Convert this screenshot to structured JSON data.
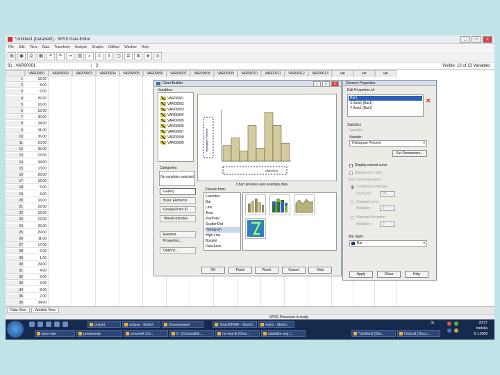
{
  "window": {
    "title": "*Untitled1 [DataSet0] - SPSS Data Editor"
  },
  "menu": [
    "File",
    "Edit",
    "View",
    "Data",
    "Transform",
    "Analyze",
    "Graphs",
    "Utilities",
    "Window",
    "Help"
  ],
  "cellbar": {
    "ref": "61 : VAR00001",
    "value": "2",
    "visible": "Visible: 13 of 13 Variables"
  },
  "columns": [
    "VAR00001",
    "VAR00002",
    "VAR00003",
    "VAR00004",
    "VAR00005",
    "VAR00006",
    "VAR00007",
    "VAR00008",
    "VAR00009",
    "VAR00010",
    "VAR00011",
    "VAR00012",
    "VAR00013",
    "var",
    "var",
    "var"
  ],
  "rows": [
    {
      "n": "1",
      "v": "16.00"
    },
    {
      "n": "2",
      "v": "8.00"
    },
    {
      "n": "3",
      "v": "6.00"
    },
    {
      "n": "4",
      "v": "26.00"
    },
    {
      "n": "5",
      "v": "16.00"
    },
    {
      "n": "6",
      "v": "15.00"
    },
    {
      "n": "7",
      "v": "30.00"
    },
    {
      "n": "8",
      "v": "24.00"
    },
    {
      "n": "9",
      "v": "31.00"
    },
    {
      "n": "10",
      "v": "36.00"
    },
    {
      "n": "11",
      "v": "10.00"
    },
    {
      "n": "12",
      "v": "35.00"
    },
    {
      "n": "13",
      "v": "13.00"
    },
    {
      "n": "14",
      "v": "34.00"
    },
    {
      "n": "15",
      "v": "13.00"
    },
    {
      "n": "16",
      "v": "26.00"
    },
    {
      "n": "17",
      "v": "16.00"
    },
    {
      "n": "18",
      "v": "5.00"
    },
    {
      "n": "19",
      "v": "3.00"
    },
    {
      "n": "20",
      "v": "16.00"
    },
    {
      "n": "21",
      "v": "22.00"
    },
    {
      "n": "22",
      "v": "16.00"
    },
    {
      "n": "23",
      "v": "12.00"
    },
    {
      "n": "24",
      "v": "26.00"
    },
    {
      "n": "25",
      "v": "29.00"
    },
    {
      "n": "26",
      "v": "11.00"
    },
    {
      "n": "27",
      "v": "17.00"
    },
    {
      "n": "28",
      "v": "6.00"
    },
    {
      "n": "29",
      "v": "1.00"
    },
    {
      "n": "30",
      "v": "29.00"
    },
    {
      "n": "31",
      "v": "4.00"
    },
    {
      "n": "32",
      "v": "9.00"
    },
    {
      "n": "33",
      "v": "3.00"
    },
    {
      "n": "34",
      "v": "8.00"
    },
    {
      "n": "35",
      "v": "2.00"
    },
    {
      "n": "36",
      "v": "34.00"
    }
  ],
  "sheet_tabs": [
    "Data View",
    "Variable View"
  ],
  "status": "SPSS Processor is ready",
  "chart_builder": {
    "title": "Chart Builder",
    "variables_label": "Variables:",
    "variables": [
      "VAR00001",
      "VAR00002",
      "VAR00003",
      "VAR00004",
      "VAR00005",
      "VAR00006",
      "VAR00007",
      "VAR00008",
      "VAR00009"
    ],
    "categories_label": "Categories:",
    "no_variables": "No variables selected",
    "preview_caption": "Chart preview uses example data",
    "y_axis": "Histogram Percent",
    "x_axis": "VAR00001",
    "tabs": [
      "Gallery",
      "Basic Elements",
      "Groups/Point ID",
      "Titles/Footnotes"
    ],
    "element_properties_btn": "Element Properties...",
    "options_btn": "Options...",
    "choose_from": "Choose from:",
    "gallery": [
      "Favorites",
      "Bar",
      "Line",
      "Area",
      "Pie/Polar",
      "Scatter/Dot",
      "Histogram",
      "High-Low",
      "Boxplot",
      "Dual Axes"
    ],
    "buttons": [
      "OK",
      "Paste",
      "Reset",
      "Cancel",
      "Help"
    ],
    "preview_values": [
      6,
      9,
      4,
      14,
      5,
      19,
      14,
      7
    ]
  },
  "element_properties": {
    "title": "Element Properties",
    "edit_label": "Edit Properties of:",
    "elements": [
      "Bar1",
      "X-Axis1 (Bar1)",
      "Y-Axis1 (Bar1)"
    ],
    "statistics_label": "Statistics",
    "variable_label": "Variable:",
    "statistic_label": "Statistic:",
    "statistic_value": "Histogram Percent",
    "set_parameters": "Set Parameters...",
    "normal_curve": "Display normal curve",
    "error_bars": "Display error bars",
    "error_represent": "Error Bars Represent",
    "confidence": "Confidence intervals",
    "level_label": "Level (%):",
    "level_value": "95",
    "std_error": "Standard error",
    "std_dev": "Standard deviation",
    "multiplier_label": "Multiplier:",
    "multiplier_value": "2",
    "bar_style_label": "Bar Style:",
    "bar_style": "Bar",
    "buttons": [
      "Apply",
      "Close",
      "Help"
    ]
  },
  "taskbar": {
    "quick": [
      "projekt",
      "eclipse - Sketch",
      "Dreamweaver",
      "SmartDRAW - Sketch",
      "Index - Sketch"
    ],
    "row2": [
      "spss vaje",
      "predavanja",
      "povzetek (Co...",
      "2 - [Compatibili...",
      "na vegi dl (Ome...",
      "statistike ang [...",
      "*Untitled1 [Dat...",
      "Output1 [Docu..."
    ],
    "lang": "SL",
    "time": "20:57",
    "day": "nedelja",
    "date": "6.1.2008"
  }
}
